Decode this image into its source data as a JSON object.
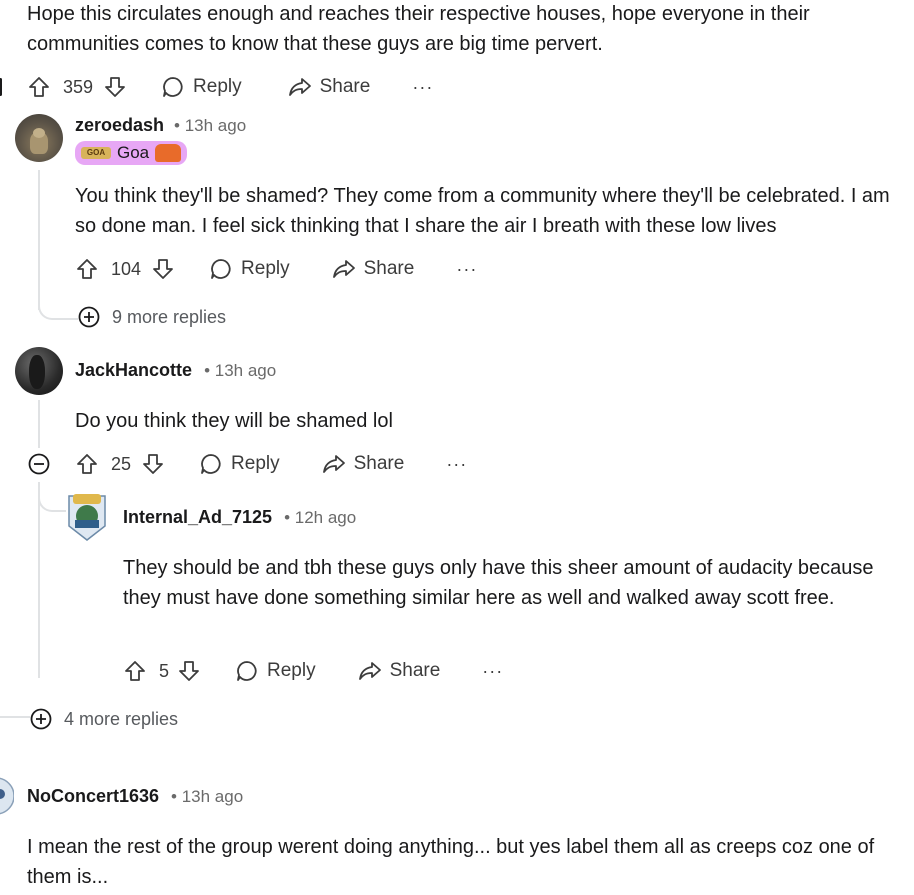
{
  "top_comment": {
    "body": "Hope this circulates enough and reaches their respective houses, hope everyone in their communities comes to know that these guys are big time pervert.",
    "votes": "359",
    "reply_label": "Reply",
    "share_label": "Share",
    "more_label": "···"
  },
  "comment_zeroedash": {
    "username": "zeroedash",
    "time": "• 13h ago",
    "flair": "Goa",
    "body": "You think they'll be shamed? They come from a community where they'll be celebrated. I am so done man. I feel sick thinking that I share the air I breath with these low lives",
    "votes": "104",
    "reply_label": "Reply",
    "share_label": "Share",
    "more_label": "···",
    "more_replies": "9 more replies"
  },
  "comment_jack": {
    "username": "JackHancotte",
    "time": "• 13h ago",
    "body": "Do you think they will be shamed lol",
    "votes": "25",
    "reply_label": "Reply",
    "share_label": "Share",
    "more_label": "···"
  },
  "comment_internal": {
    "username": "Internal_Ad_7125",
    "time": "• 12h ago",
    "body": "They should be and tbh these guys only have this sheer amount of audacity because they must have done something similar here as well and walked away scott free.",
    "votes": "5",
    "reply_label": "Reply",
    "share_label": "Share",
    "more_label": "···",
    "more_replies": "4 more replies"
  },
  "comment_noconcert": {
    "username": "NoConcert1636",
    "time": "• 13h ago",
    "body": "I mean the rest of the group werent doing anything... but yes label them all as creeps coz one of them is..."
  },
  "colors": {
    "text": "#1a1a1b",
    "meta": "#6a6a6a",
    "thread_line": "#e0e2e4",
    "flair_bg": "#e7a7f5"
  }
}
